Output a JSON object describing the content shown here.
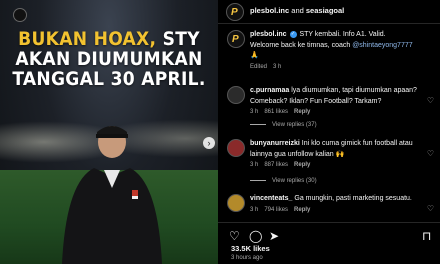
{
  "post_image": {
    "headline_highlight": "BUKAN HOAX,",
    "headline_rest": "STY",
    "headline_line2": "AKAN DIUMUMKAN",
    "headline_line3": "TANGGAL 30 APRIL."
  },
  "header": {
    "account_1": "plesbol.inc",
    "joiner": "and",
    "account_2": "seasiagoal"
  },
  "caption": {
    "username": "plesbol.inc",
    "text_1": "STY kembali. Info A1. Valid.",
    "text_2": "Welcome back ke timnas, coach",
    "mention": "@shintaeyong7777",
    "text_3": "🙏",
    "edited": "Edited",
    "time": "3 h"
  },
  "comments": [
    {
      "username": "c.purnamaa",
      "text": "lya diumumkan, tapi diumumkan apaan? Comeback? Iklan? Fun Football? Tarkam?",
      "time": "3 h",
      "likes": "861 likes",
      "reply": "Reply",
      "view_replies": "View replies (37)"
    },
    {
      "username": "bunyanurreizki",
      "text": "Ini klo cuma gimick fun football atau lainnya gua unfollow kalian 🙌",
      "time": "3 h",
      "likes": "887 likes",
      "reply": "Reply",
      "view_replies": "View replies (30)"
    },
    {
      "username": "vincenteats_",
      "text": "Ga mungkin, pasti marketing sesuatu.",
      "time": "3 h",
      "likes": "794 likes",
      "reply": "Reply"
    }
  ],
  "footer": {
    "likes": "33.5K likes",
    "time_ago": "3 hours ago"
  },
  "colors": {
    "highlight_yellow": "#f2c230",
    "link_blue": "#8fb8ea",
    "verified_blue": "#3897f0"
  }
}
